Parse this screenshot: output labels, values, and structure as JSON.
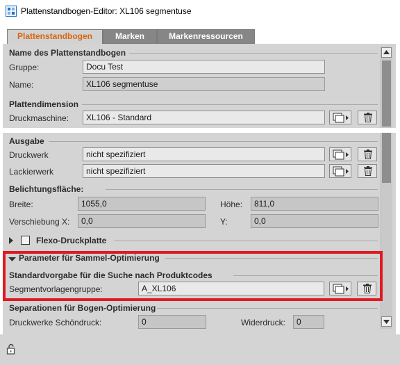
{
  "window": {
    "title": "Plattenstandbogen-Editor: XL106 segmentuse"
  },
  "tabs": [
    {
      "label": "Plattenstandbogen",
      "active": true
    },
    {
      "label": "Marken",
      "active": false
    },
    {
      "label": "Markenressourcen",
      "active": false
    }
  ],
  "name_section": {
    "title": "Name des Plattenstandbogen",
    "group_label": "Gruppe:",
    "group_value": "Docu Test",
    "name_label": "Name:",
    "name_value": "XL106 segmentuse"
  },
  "plate_dimension": {
    "title": "Plattendimension",
    "press_label": "Druckmaschine:",
    "press_value": "XL106 - Standard"
  },
  "output": {
    "title": "Ausgabe",
    "printing_unit_label": "Druckwerk",
    "printing_unit_value": "nicht spezifiziert",
    "coating_unit_label": "Lackierwerk",
    "coating_unit_value": "nicht spezifiziert"
  },
  "exposure": {
    "title": "Belichtungsfläche:",
    "width_label": "Breite:",
    "width_value": "1055,0",
    "height_label": "Höhe:",
    "height_value": "811,0",
    "shift_x_label": "Verschiebung X:",
    "shift_x_value": "0,0",
    "y_label": "Y:",
    "y_value": "0,0"
  },
  "flexo": {
    "label": "Flexo-Druckplatte",
    "expanded": false,
    "checked": false
  },
  "gang_optimization": {
    "title": "Parameter für Sammel-Optimierung",
    "expanded": true,
    "subtitle": "Standardvorgabe für die Suche nach Produktcodes",
    "segment_group_label": "Segmentvorlagengruppe:",
    "segment_group_value": "A_XL106"
  },
  "separations": {
    "title": "Separationen für Bogen-Optimierung",
    "front_label": "Druckwerke Schöndruck:",
    "front_value": "0",
    "back_label": "Widerdruck:",
    "back_value": "0"
  },
  "colors": {
    "accent": "#d9650f",
    "highlight": "#e01a22",
    "panel": "#d4d4d4"
  },
  "icons": [
    "app-icon",
    "select-dialog-icon",
    "trash-icon",
    "lock-icon",
    "scroll-up-icon",
    "scroll-down-icon",
    "triangle-down-icon",
    "triangle-right-icon"
  ]
}
